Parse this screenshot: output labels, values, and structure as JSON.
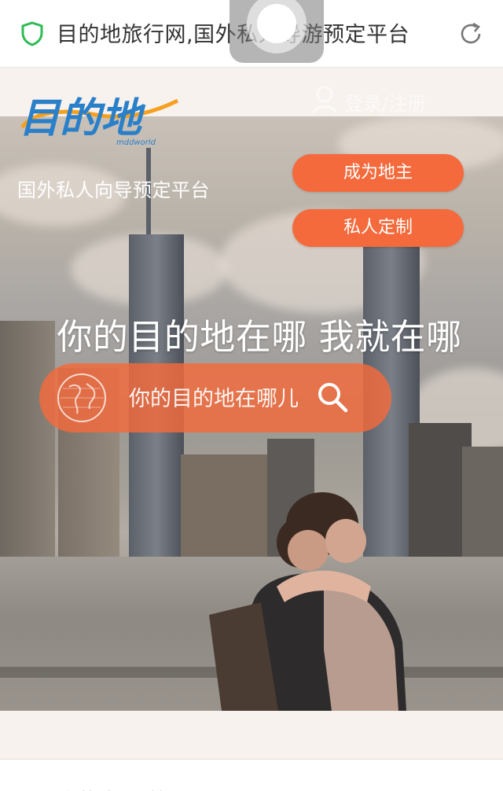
{
  "browser": {
    "page_title": "目的地旅行网,国外私人导游预定平台"
  },
  "header": {
    "logo_sub": "mddworld",
    "user_label": "登录/注册"
  },
  "hero": {
    "tagline": "国外私人向导预定平台",
    "become_host_label": "成为地主",
    "custom_trip_label": "私人定制",
    "slogan": "你的目的地在哪 我就在哪",
    "search": {
      "placeholder": "你的目的地在哪儿"
    }
  },
  "footer": {
    "peek_text": "你即在的位日: 首页"
  },
  "colors": {
    "accent": "#f46a3c",
    "shield": "#2dbb55",
    "logo_blue": "#2a7fc9",
    "logo_orange": "#f5a021"
  },
  "icons": [
    "shield-icon",
    "reload-icon",
    "user-icon",
    "globe-icon",
    "search-icon"
  ]
}
